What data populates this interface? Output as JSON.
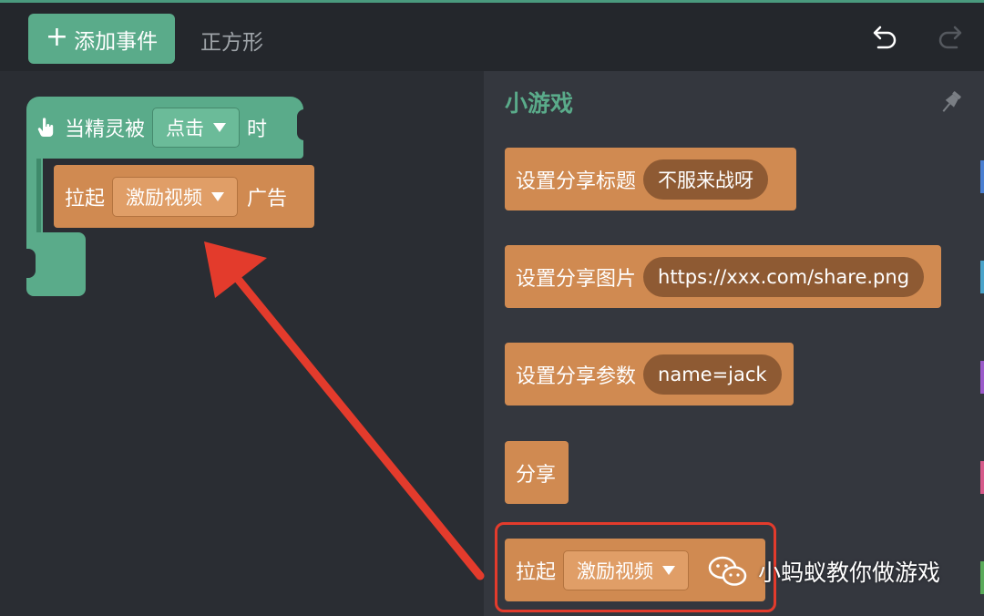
{
  "topbar": {
    "add_event_label": "添加事件",
    "sprite_name": "正方形"
  },
  "workspace": {
    "hat_block": {
      "prefix": "当精灵被",
      "event_dropdown": "点击",
      "suffix": "时"
    },
    "ad_block": {
      "prefix": "拉起",
      "ad_type_dropdown": "激励视频",
      "suffix": "广告"
    }
  },
  "toolbox": {
    "title": "小游戏",
    "blocks": [
      {
        "label": "设置分享标题",
        "value": "不服来战呀"
      },
      {
        "label": "设置分享图片",
        "value": "https://xxx.com/share.png"
      },
      {
        "label": "设置分享参数",
        "value": "name=jack"
      },
      {
        "label": "分享"
      },
      {
        "prefix": "拉起",
        "dropdown": "激励视频"
      }
    ],
    "category_marks": [
      "#4a7fd1",
      "#4aa3c9",
      "#9a5ac9",
      "#d65a8a",
      "#5aab5a"
    ]
  },
  "watermark": {
    "text": "小蚂蚁教你做游戏"
  },
  "colors": {
    "event_green": "#5aab8a",
    "block_orange": "#d08a51",
    "highlight_red": "#e33b2c"
  }
}
